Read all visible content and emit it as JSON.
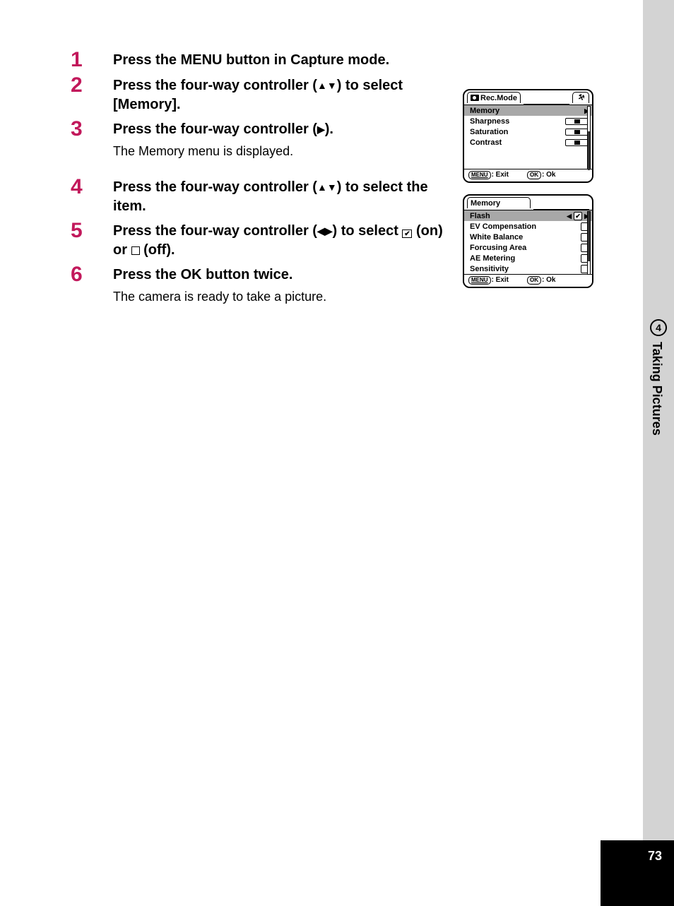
{
  "sidebar": {
    "chapter_number": "4",
    "chapter_title": "Taking Pictures",
    "page_number": "73"
  },
  "steps": [
    {
      "num": "1",
      "title": "Press the MENU button in Capture mode.",
      "desc": ""
    },
    {
      "num": "2",
      "title_pre": "Press the four-way controller (",
      "title_glyph": "▲▼",
      "title_post": ") to select [Memory].",
      "desc": ""
    },
    {
      "num": "3",
      "title_pre": "Press the four-way controller (",
      "title_glyph": "▶",
      "title_post": ").",
      "desc": "The Memory menu is displayed."
    },
    {
      "num": "4",
      "title_pre": "Press the four-way controller (",
      "title_glyph": "▲▼",
      "title_post": ") to select the item.",
      "desc": ""
    },
    {
      "num": "5",
      "title_pre": "Press the four-way controller (",
      "title_glyph": "◀▶",
      "title_post": ") to select",
      "title_tail_on": "(on) or",
      "title_tail_off": "(off).",
      "desc": ""
    },
    {
      "num": "6",
      "title": "Press the OK button twice.",
      "desc": "The camera is ready to take a picture."
    }
  ],
  "screen1": {
    "tab_label": "Rec.Mode",
    "rows": {
      "memory": "Memory",
      "sharpness": "Sharpness",
      "saturation": "Saturation",
      "contrast": "Contrast"
    },
    "foot_menu_btn": "MENU",
    "foot_menu_lbl": ": Exit",
    "foot_ok_btn": "OK",
    "foot_ok_lbl": ": Ok"
  },
  "screen2": {
    "tab_label": "Memory",
    "rows": {
      "flash": "Flash",
      "ev": "EV Compensation",
      "wb": "White Balance",
      "focus": "Forcusing Area",
      "ae": "AE Metering",
      "sens": "Sensitivity"
    },
    "left_arrow": "◀",
    "flash_checked": "✔",
    "foot_menu_btn": "MENU",
    "foot_menu_lbl": ": Exit",
    "foot_ok_btn": "OK",
    "foot_ok_lbl": ": Ok"
  }
}
